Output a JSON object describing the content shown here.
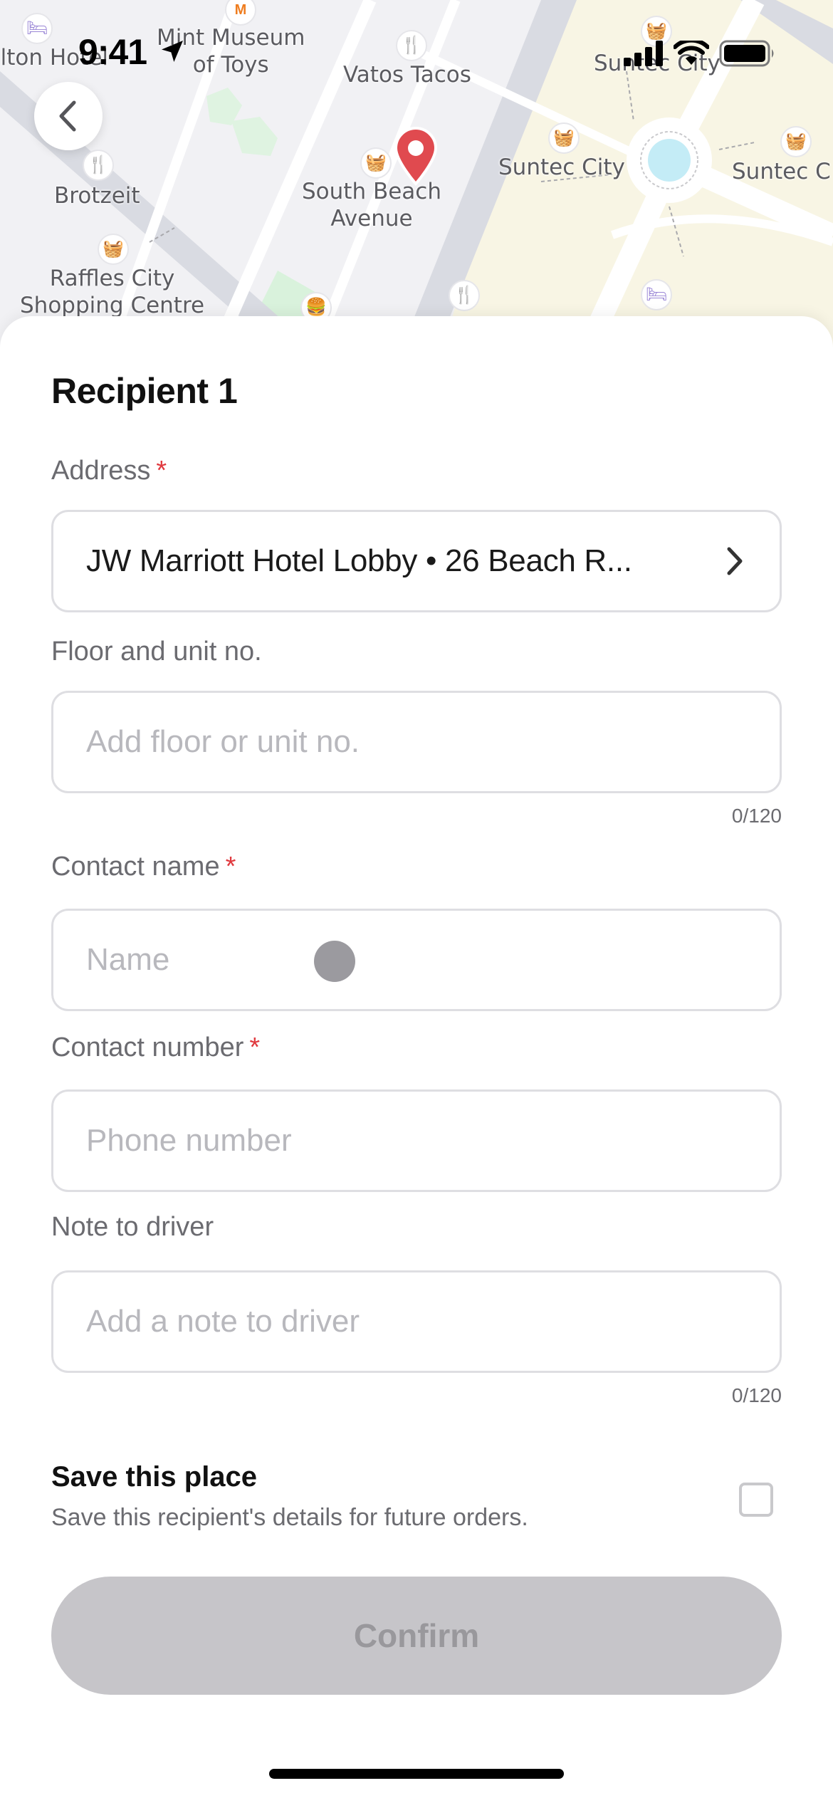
{
  "status_bar": {
    "time": "9:41"
  },
  "map": {
    "labels": {
      "hotel_partial": "ilton Hotel",
      "mint_museum": "Mint Museum\nof Toys",
      "vatos_tacos": "Vatos Tacos",
      "suntec_top": "Suntec City",
      "brotzeit": "Brotzeit",
      "south_beach": "South Beach\nAvenue",
      "suntec_mid": "Suntec City",
      "suntec_right": "Suntec C",
      "raffles": "Raffles City\nShopping Centre"
    },
    "colors": {
      "pin": "#e04a4f",
      "poi_orange": "#ef7d1f",
      "poi_purple": "#9a86d6",
      "park": "#d9f2dc",
      "suntec_area": "#f8f5e4",
      "water": "#c4ecf6",
      "road": "#d9dbe2"
    }
  },
  "sheet": {
    "title": "Recipient 1",
    "address": {
      "label": "Address",
      "required_mark": "*",
      "value": "JW Marriott Hotel Lobby • 26 Beach R..."
    },
    "floor": {
      "label": "Floor and unit no.",
      "placeholder": "Add floor or unit no.",
      "counter": "0/120"
    },
    "contact_name": {
      "label": "Contact name",
      "required_mark": "*",
      "placeholder": "Name"
    },
    "contact_number": {
      "label": "Contact number",
      "required_mark": "*",
      "placeholder": "Phone number"
    },
    "note": {
      "label": "Note to driver",
      "placeholder": "Add a note to driver",
      "counter": "0/120"
    },
    "save_place": {
      "title": "Save this place",
      "description": "Save this recipient's details for future orders.",
      "checked": false
    },
    "confirm_label": "Confirm",
    "colors": {
      "required": "#e0393e",
      "confirm_disabled_bg": "#c6c5c9",
      "confirm_disabled_text": "#99989c"
    }
  }
}
